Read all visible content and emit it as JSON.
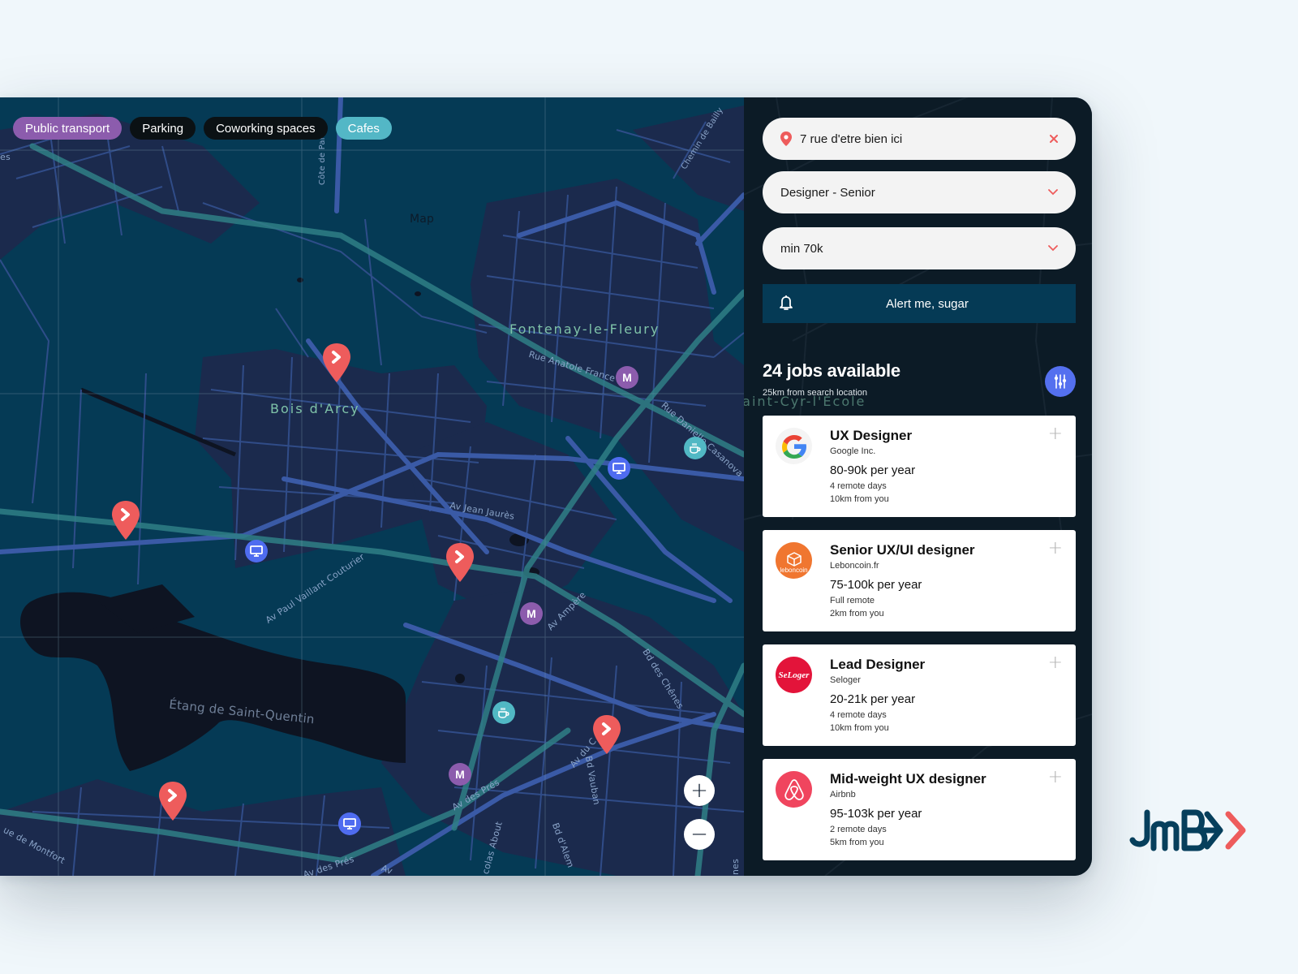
{
  "map": {
    "title_label": "Map",
    "chips": [
      {
        "label": "Public transport",
        "style": "purple"
      },
      {
        "label": "Parking",
        "style": "black"
      },
      {
        "label": "Coworking spaces",
        "style": "black"
      },
      {
        "label": "Cafes",
        "style": "teal"
      }
    ],
    "place_labels": {
      "fontenay": "Fontenay-le-Fleury",
      "bois": "Bois d'Arcy",
      "etang": "Étang de Saint-Quentin",
      "saint_cyr": "Saint-Cyr-l'École"
    },
    "street_labels": {
      "cote_paris": "Côte de Paris",
      "chemin_bailly": "Chemin de Bailly",
      "anatole": "Rue Anatole France",
      "casanova": "Rue Danielle Casanova",
      "jaures": "Av Jean Jaurès",
      "couturier": "Av Paul Vaillant Couturier",
      "ampere": "Av Ampère",
      "chenes": "Bd des Chênes",
      "av_du_c": "Av du C",
      "vauban": "Bd Vauban",
      "des_pres": "Av des Prés",
      "des_pres2": "Av des Prés",
      "about": "colas About",
      "alem": "Bd d'Alem",
      "montfort": "ue de Montfort",
      "nes": "nes",
      "av": "Av",
      "es": "es"
    },
    "poi_icons": {
      "metro": "M",
      "cowork": "monitor-icon",
      "cafe": "coffee-cup-icon"
    },
    "zoom_in": "+",
    "zoom_out": "−"
  },
  "search": {
    "location_value": "7 rue d'etre bien ici",
    "role_value": "Designer - Senior",
    "salary_value": "min 70k",
    "alert_label": "Alert me, sugar"
  },
  "results": {
    "title": "24 jobs available",
    "subtitle": "25km from search location"
  },
  "jobs": [
    {
      "title": "UX Designer",
      "company": "Google Inc.",
      "salary": "80-90k per year",
      "remote": "4 remote days",
      "distance": "10km from you",
      "logo": "google-logo"
    },
    {
      "title": "Senior UX/UI designer",
      "company": "Leboncoin.fr",
      "salary": "75-100k per year",
      "remote": "Full remote",
      "distance": "2km from you",
      "logo": "leboncoin-logo",
      "logo_text": "leboncoin"
    },
    {
      "title": "Lead Designer",
      "company": "Seloger",
      "salary": "20-21k per year",
      "remote": "4 remote days",
      "distance": "10km from you",
      "logo": "seloger-logo",
      "logo_text": "SeLoger"
    },
    {
      "title": "Mid-weight UX designer",
      "company": "Airbnb",
      "salary": "95-103k per year",
      "remote": "2 remote days",
      "distance": "5km from you",
      "logo": "airbnb-logo"
    }
  ],
  "colors": {
    "accent_red": "#ee5c5c",
    "purple": "#8c5cad",
    "teal": "#53b7c6",
    "blue": "#5470ef",
    "navy": "#053a55"
  },
  "brand": {
    "name": "JmB"
  }
}
